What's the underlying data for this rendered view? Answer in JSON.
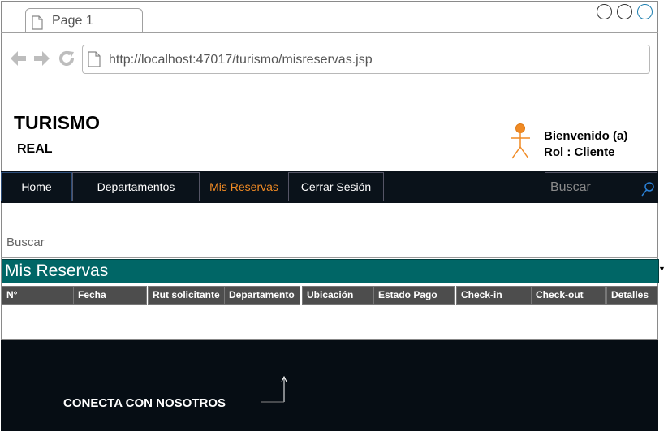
{
  "browser": {
    "tab_label": "Page 1",
    "url": "http://localhost:47017/turismo/misreservas.jsp"
  },
  "header": {
    "title": "TURISMO",
    "subtitle": "REAL",
    "welcome": "Bienvenido (a)",
    "role": "Rol : Cliente"
  },
  "nav": {
    "items": [
      {
        "label": "Home"
      },
      {
        "label": "Departamentos"
      },
      {
        "label": "Mis Reservas"
      },
      {
        "label": "Cerrar Sesión"
      }
    ],
    "search_placeholder": "Buscar"
  },
  "search": {
    "label": "Buscar"
  },
  "section": {
    "title": "Mis Reservas"
  },
  "table": {
    "columns": [
      "N°",
      "Fecha",
      "Rut solicitante",
      "Departamento",
      "Ubicación",
      "Estado Pago",
      "Check-in",
      "Check-out",
      "Detalles"
    ]
  },
  "footer": {
    "connect": "CONECTA CON NOSOTROS"
  },
  "colors": {
    "navbar": "#0a121a",
    "active_nav": "#f08a24",
    "section_bar": "#006666",
    "table_header": "#4d4d4d",
    "footer": "#060d14"
  }
}
